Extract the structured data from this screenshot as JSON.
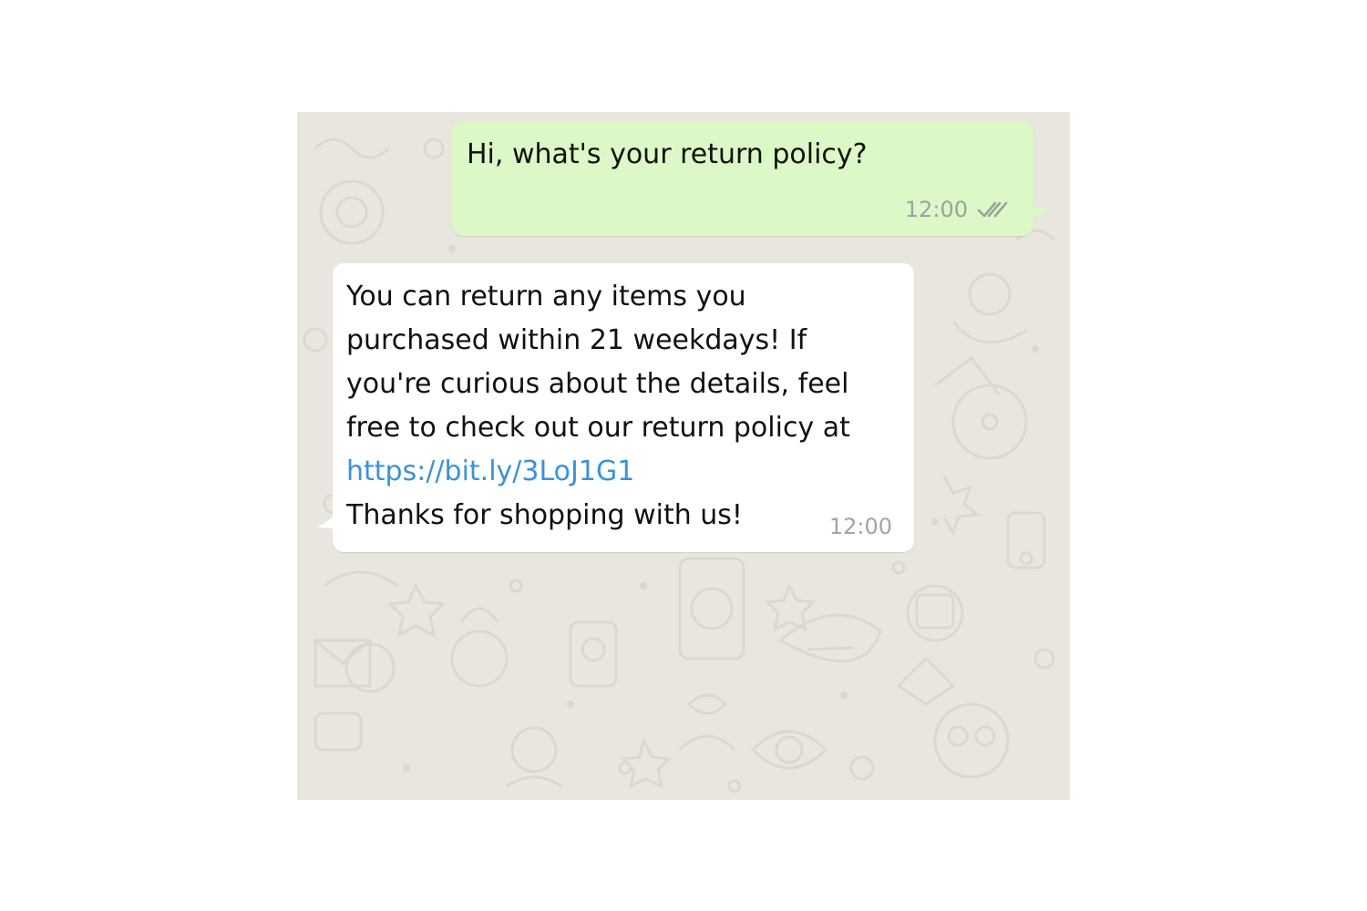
{
  "conversation": {
    "messages": [
      {
        "direction": "outgoing",
        "text": "Hi, what's your return policy?",
        "time": "12:00",
        "status": "double-check-icon"
      },
      {
        "direction": "incoming",
        "text_before_link": "You can return any items you\npurchased within 21 weekdays! If\nyou're curious about the details, feel\nfree to check out our return policy at",
        "link": "https://bit.ly/3LoJ1G1",
        "text_after_link": "Thanks for shopping with us!",
        "time": "12:00"
      }
    ]
  },
  "colors": {
    "chat_background": "#e9e6df",
    "outgoing_bubble": "#dcf8c6",
    "incoming_bubble": "#ffffff",
    "link": "#3a93d9",
    "timestamp": "#9aa39a"
  }
}
